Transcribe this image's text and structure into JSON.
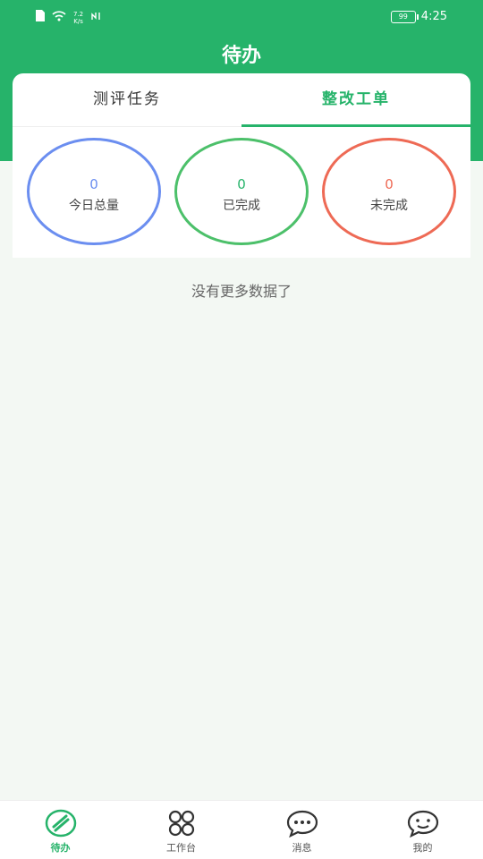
{
  "statusbar": {
    "net_speed_value": "7.2",
    "net_speed_unit": "K/s",
    "battery": "99",
    "time": "4:25"
  },
  "header": {
    "title": "待办"
  },
  "tabs": [
    {
      "label": "测评任务",
      "active": false
    },
    {
      "label": "整改工单",
      "active": true
    }
  ],
  "stats": {
    "total": {
      "value": "0",
      "label": "今日总量",
      "color": "#6b8ef0"
    },
    "done": {
      "value": "0",
      "label": "已完成",
      "color": "#26b36a"
    },
    "undone": {
      "value": "0",
      "label": "未完成",
      "color": "#ee6a55"
    }
  },
  "empty_text": "没有更多数据了",
  "tabbar": {
    "items": [
      {
        "label": "待办",
        "icon": "todo-icon",
        "active": true
      },
      {
        "label": "工作台",
        "icon": "grid-icon",
        "active": false
      },
      {
        "label": "消息",
        "icon": "chat-bubble-icon",
        "active": false
      },
      {
        "label": "我的",
        "icon": "face-icon",
        "active": false
      }
    ]
  },
  "colors": {
    "primary": "#26b36a",
    "background": "#f3f8f3"
  }
}
